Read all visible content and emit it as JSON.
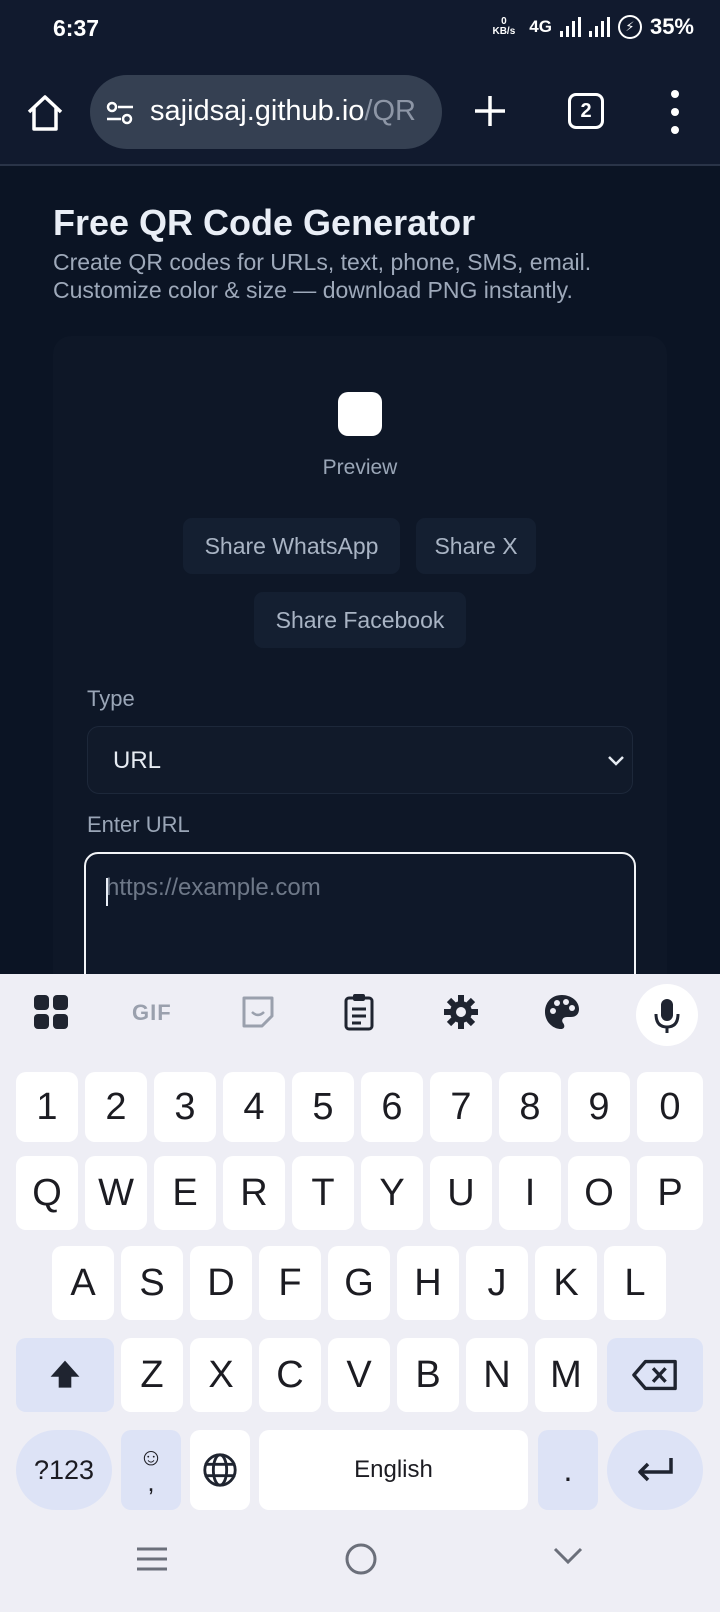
{
  "status_bar": {
    "time": "6:37",
    "data_speed_value": "0",
    "data_speed_unit": "KB/s",
    "network": "4G",
    "battery": "35%"
  },
  "browser": {
    "url_main": "sajidsaj.github.io",
    "url_faded": "/QR",
    "tab_count": "2",
    "icons": [
      "home-icon",
      "site-settings-icon",
      "new-tab-icon",
      "tab-switcher-icon",
      "overflow-menu-icon"
    ]
  },
  "page": {
    "title": "Free QR Code Generator",
    "subtitle_line1": "Create QR codes for URLs, text, phone, SMS, email.",
    "subtitle_line2": "Customize color & size — download PNG instantly.",
    "preview_label": "Preview",
    "share_whatsapp": "Share WhatsApp",
    "share_x": "Share X",
    "share_facebook": "Share Facebook",
    "type_label": "Type",
    "type_value": "URL",
    "url_label": "Enter URL",
    "url_placeholder": "https://example.com",
    "url_value": ""
  },
  "keyboard": {
    "row_numbers": [
      "1",
      "2",
      "3",
      "4",
      "5",
      "6",
      "7",
      "8",
      "9",
      "0"
    ],
    "row1": [
      "Q",
      "W",
      "E",
      "R",
      "T",
      "Y",
      "U",
      "I",
      "O",
      "P"
    ],
    "row2": [
      "A",
      "S",
      "D",
      "F",
      "G",
      "H",
      "J",
      "K",
      "L"
    ],
    "row3": [
      "Z",
      "X",
      "C",
      "V",
      "B",
      "N",
      "M"
    ],
    "symbols_key": "?123",
    "emoji_comma_key": ",",
    "space_key": "English",
    "period_key": ".",
    "toolbar_icons": [
      "apps-grid-icon",
      "gif-icon",
      "sticker-icon",
      "clipboard-icon",
      "settings-gear-icon",
      "theme-palette-icon",
      "microphone-icon"
    ],
    "gif_text": "GIF"
  },
  "colors": {
    "page_background": "#0b1424",
    "browser_chrome": "#111a2e",
    "keyboard_background": "#eeeef5",
    "keyboard_special_key": "#dde3f6"
  }
}
